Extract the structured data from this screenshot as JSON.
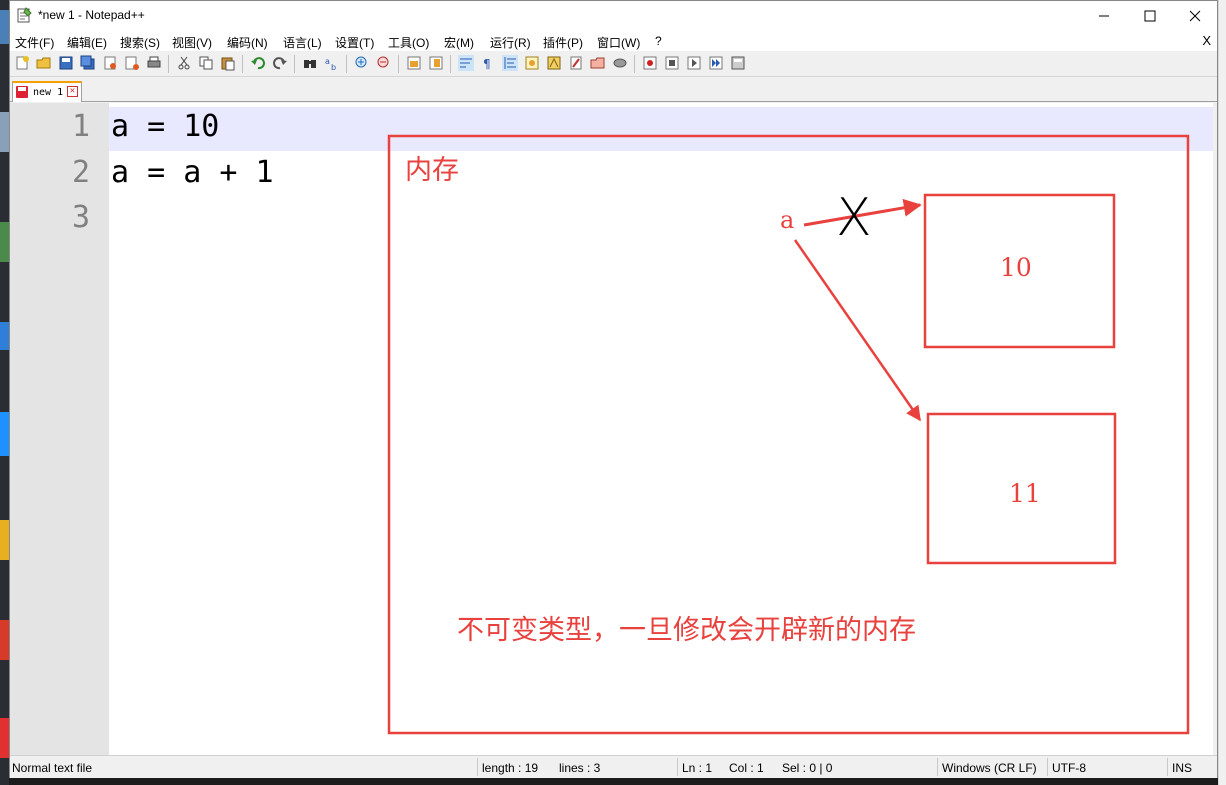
{
  "window": {
    "title": "*new 1 - Notepad++"
  },
  "menu": [
    "文件(F)",
    "编辑(E)",
    "搜索(S)",
    "视图(V)",
    "编码(N)",
    "语言(L)",
    "设置(T)",
    "工具(O)",
    "宏(M)",
    "运行(R)",
    "插件(P)",
    "窗口(W)",
    "?"
  ],
  "menu_close": "X",
  "tab": {
    "label": "new 1"
  },
  "editor": {
    "line_numbers": [
      "1",
      "2",
      "3"
    ],
    "lines": [
      "a = 10",
      "a = a + 1",
      ""
    ]
  },
  "annotation": {
    "memory_label": "内存",
    "var_label": "a",
    "old_value": "10",
    "new_value": "11",
    "cross_mark": "X",
    "note": "不可变类型，一旦修改会开辟新的内存",
    "color": "#e8413e"
  },
  "status": {
    "file_type": "Normal text file",
    "length": "length : 19",
    "lines": "lines : 3",
    "ln": "Ln : 1",
    "col": "Col : 1",
    "sel": "Sel : 0 | 0",
    "eol": "Windows (CR LF)",
    "encoding": "UTF-8",
    "mode": "INS"
  }
}
